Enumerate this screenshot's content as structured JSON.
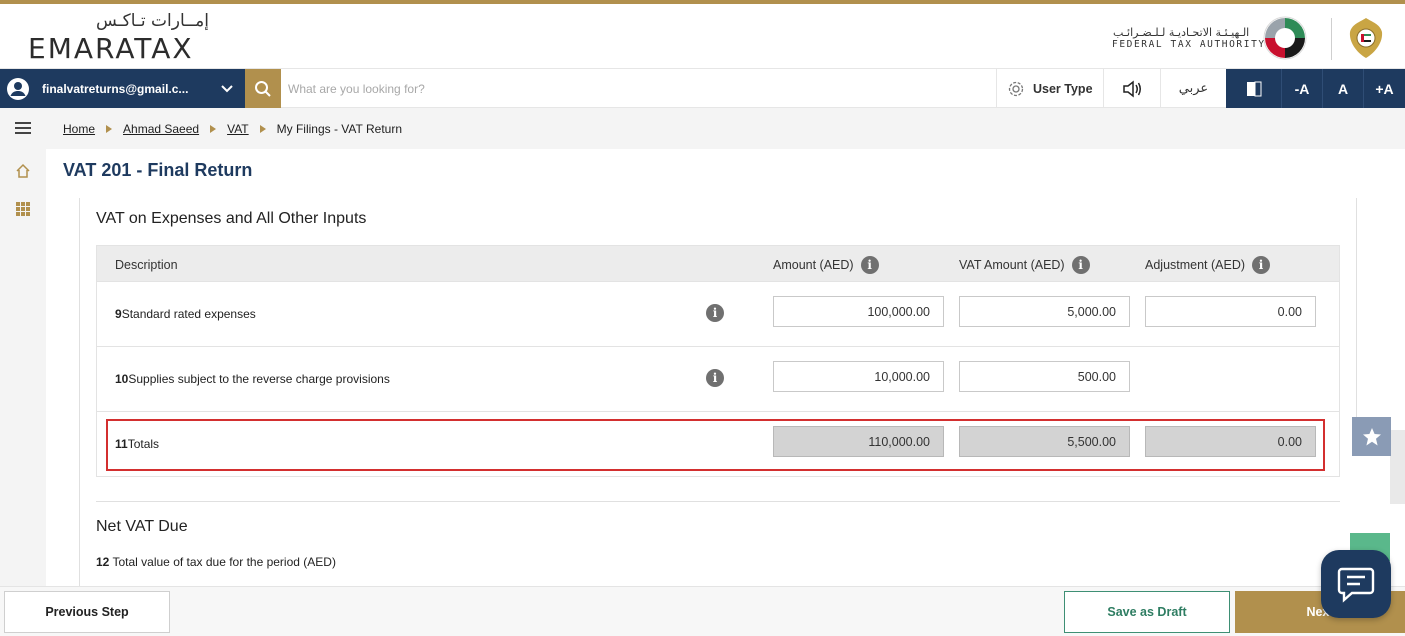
{
  "header": {
    "logo_arabic": "إمــارات تـاكـس",
    "logo_english": "EMARATAX",
    "authority_arabic": "الـهيـئـة الاتحـاديـة لـلـضـرائـب",
    "authority_english": "FEDERAL TAX AUTHORITY",
    "accent_color": "#b1904d",
    "nav_color": "#1e3a5f"
  },
  "nav": {
    "user_email": "finalvatreturns@gmail.c...",
    "search_placeholder": "What are you looking for?",
    "user_type_label": "User Type",
    "arabic_label": "عربي",
    "font_decrease": "-A",
    "font_normal": "A",
    "font_increase": "+A"
  },
  "breadcrumb": [
    {
      "label": "Home"
    },
    {
      "label": "Ahmad Saeed"
    },
    {
      "label": "VAT"
    },
    {
      "label": "My Filings - VAT Return"
    }
  ],
  "page": {
    "title": "VAT 201 - Final Return",
    "section_title": "VAT on Expenses and All Other Inputs",
    "table": {
      "headers": {
        "description": "Description",
        "amount": "Amount (AED)",
        "vat_amount": "VAT Amount (AED)",
        "adjustment": "Adjustment (AED)"
      },
      "rows": [
        {
          "number": "9",
          "label": "Standard rated expenses",
          "amount": "100,000.00",
          "vat_amount": "5,000.00",
          "adjustment": "0.00"
        },
        {
          "number": "10",
          "label": "Supplies subject to the reverse charge provisions",
          "amount": "10,000.00",
          "vat_amount": "500.00"
        },
        {
          "number": "11",
          "label": "Totals",
          "amount": "110,000.00",
          "vat_amount": "5,500.00",
          "adjustment": "0.00"
        }
      ]
    },
    "net_vat_title": "Net VAT Due",
    "net_vat_row_number": "12",
    "net_vat_row_label": "Total value of tax due for the period (AED)",
    "highlight_color": "#d32f2f"
  },
  "footer": {
    "previous_label": "Previous Step",
    "draft_label": "Save as Draft",
    "next_label": "Next"
  },
  "icons": [
    "user-avatar-icon",
    "chevron-down-icon",
    "search-icon",
    "gear-icon",
    "speaker-icon",
    "contrast-icon",
    "menu-icon",
    "home-icon",
    "grid-icon",
    "info-icon",
    "star-icon",
    "chat-icon"
  ]
}
